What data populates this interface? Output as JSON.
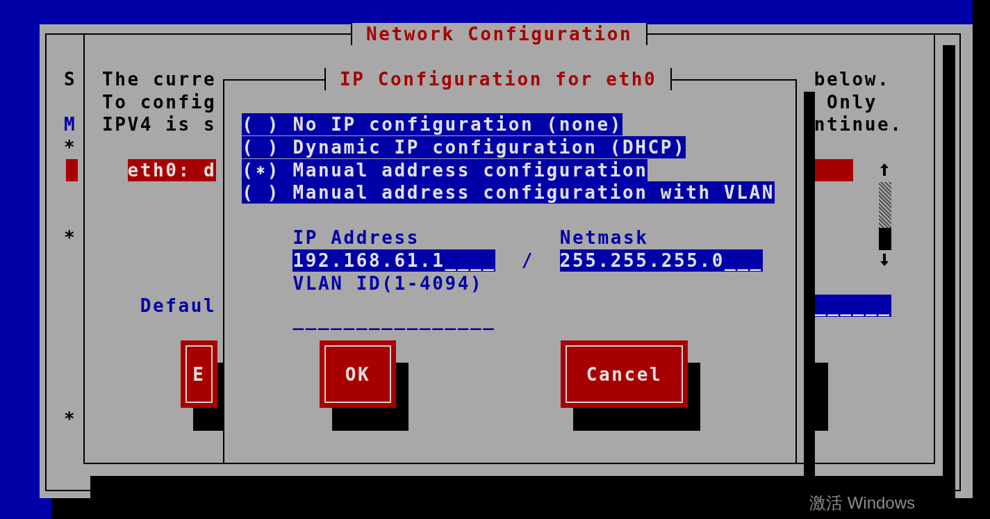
{
  "main_window": {
    "title": "Network Configuration",
    "left_marks": [
      {
        "text": "S",
        "kind": "plain"
      },
      {
        "text": "M",
        "kind": "accent"
      },
      {
        "text": "*",
        "kind": "plain"
      },
      {
        "text": "*",
        "kind": "plain"
      },
      {
        "text": "*",
        "kind": "plain"
      }
    ],
    "intro_left": [
      "The curre",
      "To config",
      "IPV4 is s"
    ],
    "intro_right": [
      "below.",
      "Only",
      "ntinue."
    ],
    "device_rows": [
      {
        "label": "eth0: d",
        "selected": true
      }
    ],
    "gateway": {
      "label": "Defaul",
      "value": "______"
    },
    "buttons": [
      {
        "label": "E"
      }
    ]
  },
  "dialog": {
    "title": "IP Configuration for eth0",
    "radio_frame": "( )",
    "options": [
      {
        "label": "No IP configuration (none)",
        "selected": false
      },
      {
        "label": "Dynamic IP configuration (DHCP)",
        "selected": false
      },
      {
        "label": "Manual address configuration",
        "selected": true
      },
      {
        "label": "Manual address configuration with VLAN",
        "selected": false
      }
    ],
    "ip_address": {
      "label": "IP Address",
      "value": "192.168.61.1____"
    },
    "separator": "/",
    "netmask": {
      "label": "Netmask",
      "value": "255.255.255.0___"
    },
    "vlan_id": {
      "label": "VLAN ID(1-4094)",
      "value": "________________"
    },
    "buttons": [
      {
        "label": "OK"
      },
      {
        "label": "Cancel"
      }
    ]
  },
  "watermark": "激活 Windows"
}
